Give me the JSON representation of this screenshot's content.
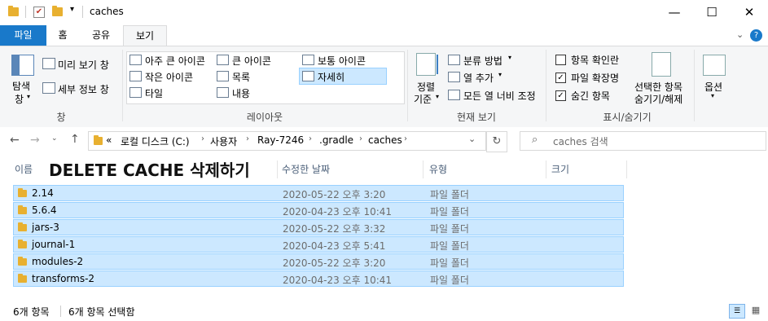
{
  "window": {
    "title": "caches",
    "minimize": "—",
    "maximize": "☐",
    "close": "✕"
  },
  "tabs": [
    {
      "label": "파일"
    },
    {
      "label": "홈"
    },
    {
      "label": "공유"
    },
    {
      "label": "보기"
    }
  ],
  "ribbon": {
    "panes": {
      "nav_pane_line1": "탐색",
      "nav_pane_line2": "창",
      "preview_pane": "미리 보기 창",
      "details_pane": "세부 정보 창",
      "group_label": "창"
    },
    "layout": {
      "xlarge_icons": "아주 큰 아이콘",
      "large_icons": "큰 아이콘",
      "medium_icons": "보통 아이콘",
      "small_icons": "작은 아이콘",
      "list": "목록",
      "details": "자세히",
      "tiles": "타일",
      "content": "내용",
      "group_label": "레이아웃"
    },
    "current_view": {
      "sort_line1": "정렬",
      "sort_line2": "기준",
      "group_by": "분류 방법",
      "add_columns": "열 추가",
      "size_all_columns": "모든 열 너비 조정",
      "group_label": "현재 보기"
    },
    "show_hide": {
      "item_checkboxes": "항목 확인란",
      "item_checkboxes_checked": false,
      "file_extensions": "파일 확장명",
      "file_extensions_checked": true,
      "hidden_items": "숨긴 항목",
      "hidden_items_checked": true,
      "hide_selected_line1": "선택한 항목",
      "hide_selected_line2": "숨기기/해제",
      "group_label": "표시/숨기기"
    },
    "options": {
      "label": "옵션"
    }
  },
  "address": {
    "crumbs": [
      "«",
      "로컬 디스크 (C:)",
      "사용자",
      "Ray-7246",
      ".gradle",
      "caches"
    ],
    "search_placeholder": "caches 검색"
  },
  "overlay_text": "DELETE CACHE 삭제하기",
  "columns": {
    "name": "이름",
    "modified": "수정한 날짜",
    "type": "유형",
    "size": "크기"
  },
  "files": [
    {
      "name": "2.14",
      "modified": "2020-05-22 오후 3:20",
      "type": "파일 폴더"
    },
    {
      "name": "5.6.4",
      "modified": "2020-04-23 오후 10:41",
      "type": "파일 폴더"
    },
    {
      "name": "jars-3",
      "modified": "2020-05-22 오후 3:32",
      "type": "파일 폴더"
    },
    {
      "name": "journal-1",
      "modified": "2020-04-23 오후 5:41",
      "type": "파일 폴더"
    },
    {
      "name": "modules-2",
      "modified": "2020-05-22 오후 3:20",
      "type": "파일 폴더"
    },
    {
      "name": "transforms-2",
      "modified": "2020-04-23 오후 10:41",
      "type": "파일 폴더"
    }
  ],
  "status": {
    "item_count": "6개 항목",
    "selected_count": "6개 항목 선택함"
  },
  "colors": {
    "accent": "#1979ca",
    "selection_bg": "#cce8ff",
    "selection_border": "#99d1ff",
    "folder": "#e8b030"
  }
}
